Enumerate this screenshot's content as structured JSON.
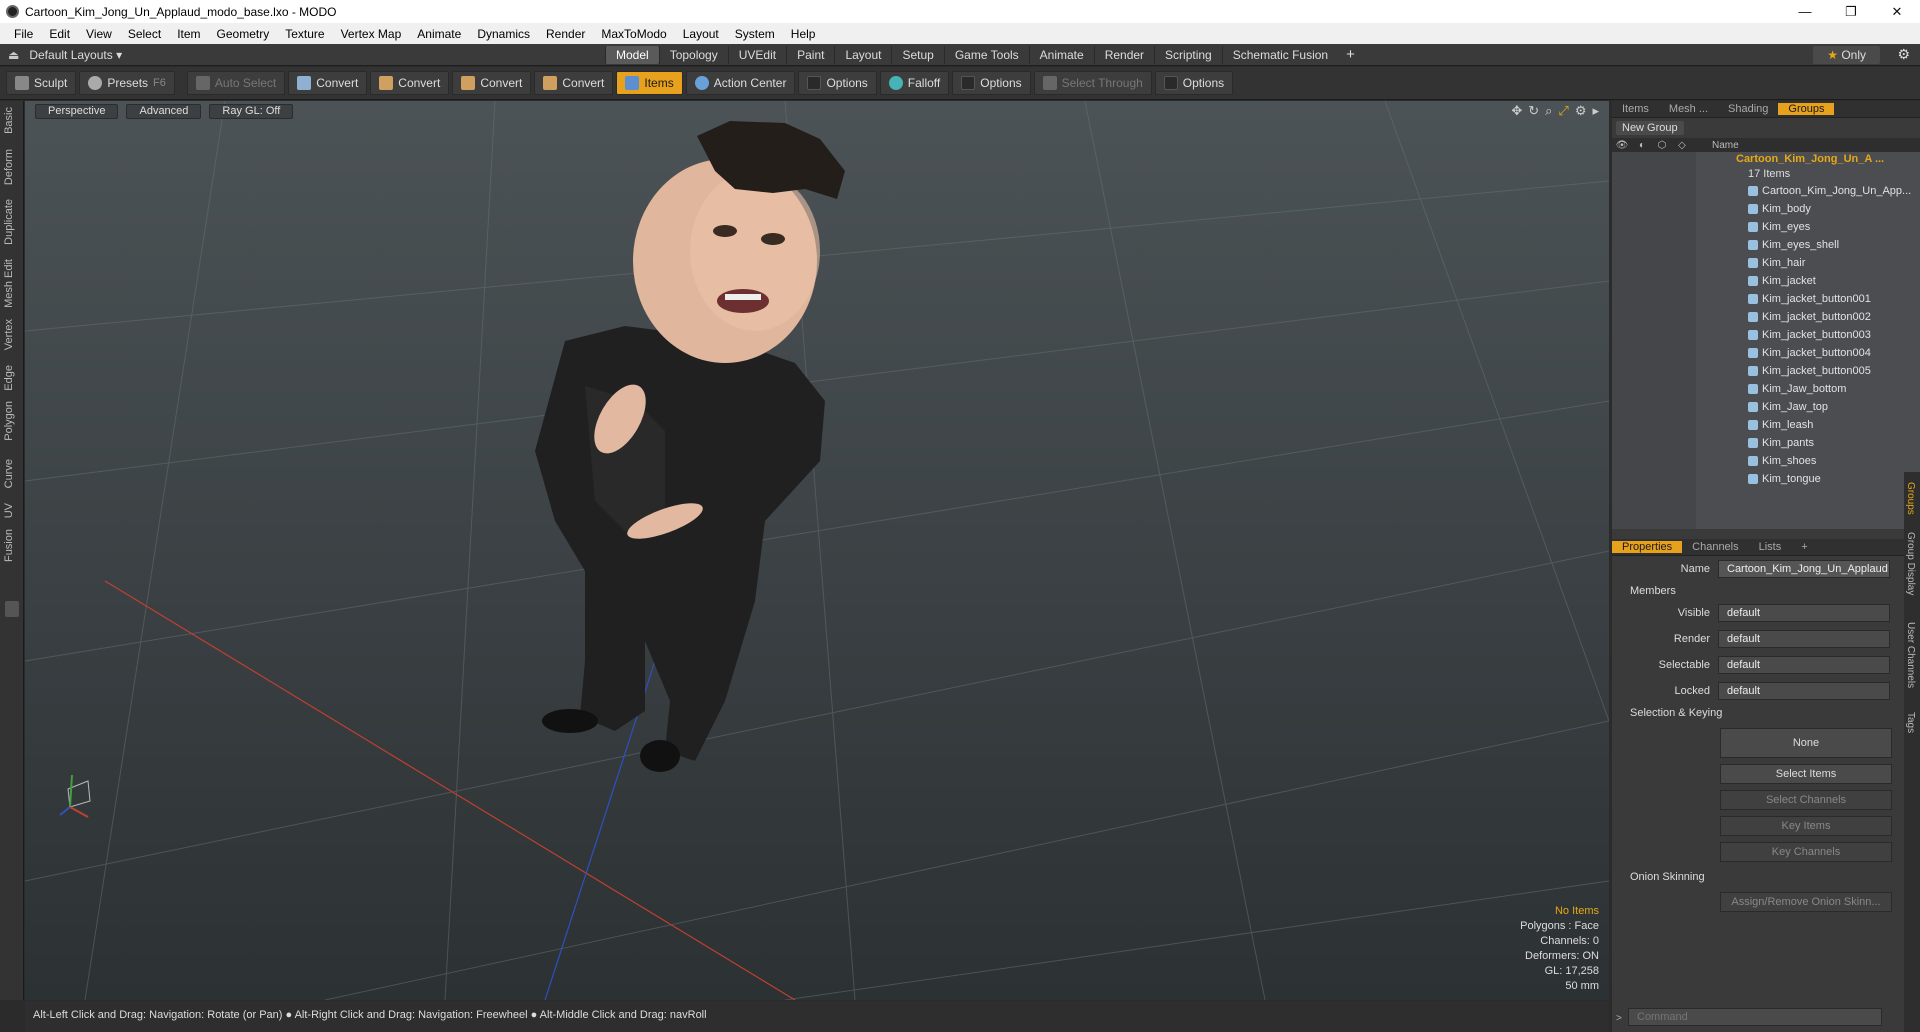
{
  "window": {
    "title": "Cartoon_Kim_Jong_Un_Applaud_modo_base.lxo - MODO",
    "minimize": "—",
    "maximize": "❐",
    "close": "✕"
  },
  "menu": [
    "File",
    "Edit",
    "View",
    "Select",
    "Item",
    "Geometry",
    "Texture",
    "Vertex Map",
    "Animate",
    "Dynamics",
    "Render",
    "MaxToModo",
    "Layout",
    "System",
    "Help"
  ],
  "layoutbar": {
    "layout_name": "Default Layouts ▾",
    "tabs": [
      "Model",
      "Topology",
      "UVEdit",
      "Paint",
      "Layout",
      "Setup",
      "Game Tools",
      "Animate",
      "Render",
      "Scripting",
      "Schematic Fusion"
    ],
    "active_tab": "Model",
    "add": "+",
    "only": "Only"
  },
  "toolbar": {
    "sculpt": "Sculpt",
    "presets": "Presets",
    "presets_key": "F6",
    "auto_select": "Auto Select",
    "convert1": "Convert",
    "convert2": "Convert",
    "convert3": "Convert",
    "convert4": "Convert",
    "items": "Items",
    "action_center": "Action Center",
    "options1": "Options",
    "falloff": "Falloff",
    "options2": "Options",
    "select_through": "Select Through",
    "options3": "Options"
  },
  "left_tabs": [
    "Basic",
    "Deform",
    "Duplicate",
    "Mesh Edit",
    "Vertex",
    "Edge",
    "Polygon",
    "Curve",
    "UV",
    "Fusion"
  ],
  "viewport": {
    "view": "Perspective",
    "shading": "Advanced",
    "raygl": "Ray GL: Off",
    "info": {
      "selection": "No Items",
      "polygons": "Polygons : Face",
      "channels": "Channels: 0",
      "deformers": "Deformers: ON",
      "gl": "GL: 17,258",
      "units": "50 mm"
    }
  },
  "status": "Alt-Left Click and Drag: Navigation: Rotate (or Pan) ● Alt-Right Click and Drag: Navigation: Freewheel ● Alt-Middle Click and Drag: navRoll",
  "groups_panel": {
    "tabs": [
      "Items",
      "Mesh ...",
      "Shading",
      "Groups"
    ],
    "active_tab": "Groups",
    "new_group": "New Group",
    "name_header": "Name",
    "group_name": "Cartoon_Kim_Jong_Un_A ...",
    "group_count": "17 Items",
    "items": [
      "Cartoon_Kim_Jong_Un_App...",
      "Kim_body",
      "Kim_eyes",
      "Kim_eyes_shell",
      "Kim_hair",
      "Kim_jacket",
      "Kim_jacket_button001",
      "Kim_jacket_button002",
      "Kim_jacket_button003",
      "Kim_jacket_button004",
      "Kim_jacket_button005",
      "Kim_Jaw_bottom",
      "Kim_Jaw_top",
      "Kim_leash",
      "Kim_pants",
      "Kim_shoes",
      "Kim_tongue"
    ]
  },
  "properties": {
    "tabs": [
      "Properties",
      "Channels",
      "Lists",
      "+"
    ],
    "active_tab": "Properties",
    "name_label": "Name",
    "name_value": "Cartoon_Kim_Jong_Un_Applaud",
    "members": "Members",
    "visible_label": "Visible",
    "visible_value": "default",
    "render_label": "Render",
    "render_value": "default",
    "selectable_label": "Selectable",
    "selectable_value": "default",
    "locked_label": "Locked",
    "locked_value": "default",
    "selection_keying": "Selection & Keying",
    "none": "None",
    "select_items": "Select Items",
    "select_channels": "Select Channels",
    "key_items": "Key Items",
    "key_channels": "Key Channels",
    "onion_skinning": "Onion Skinning",
    "assign_remove": "Assign/Remove Onion Skinn...",
    "side_tabs": [
      "Groups",
      "Group Display",
      "User Channels",
      "Tags"
    ]
  },
  "command": {
    "placeholder": "Command"
  },
  "colors": {
    "accent": "#e7a11d",
    "viewport_top": "#4c5356",
    "viewport_bottom": "#2c3133"
  }
}
